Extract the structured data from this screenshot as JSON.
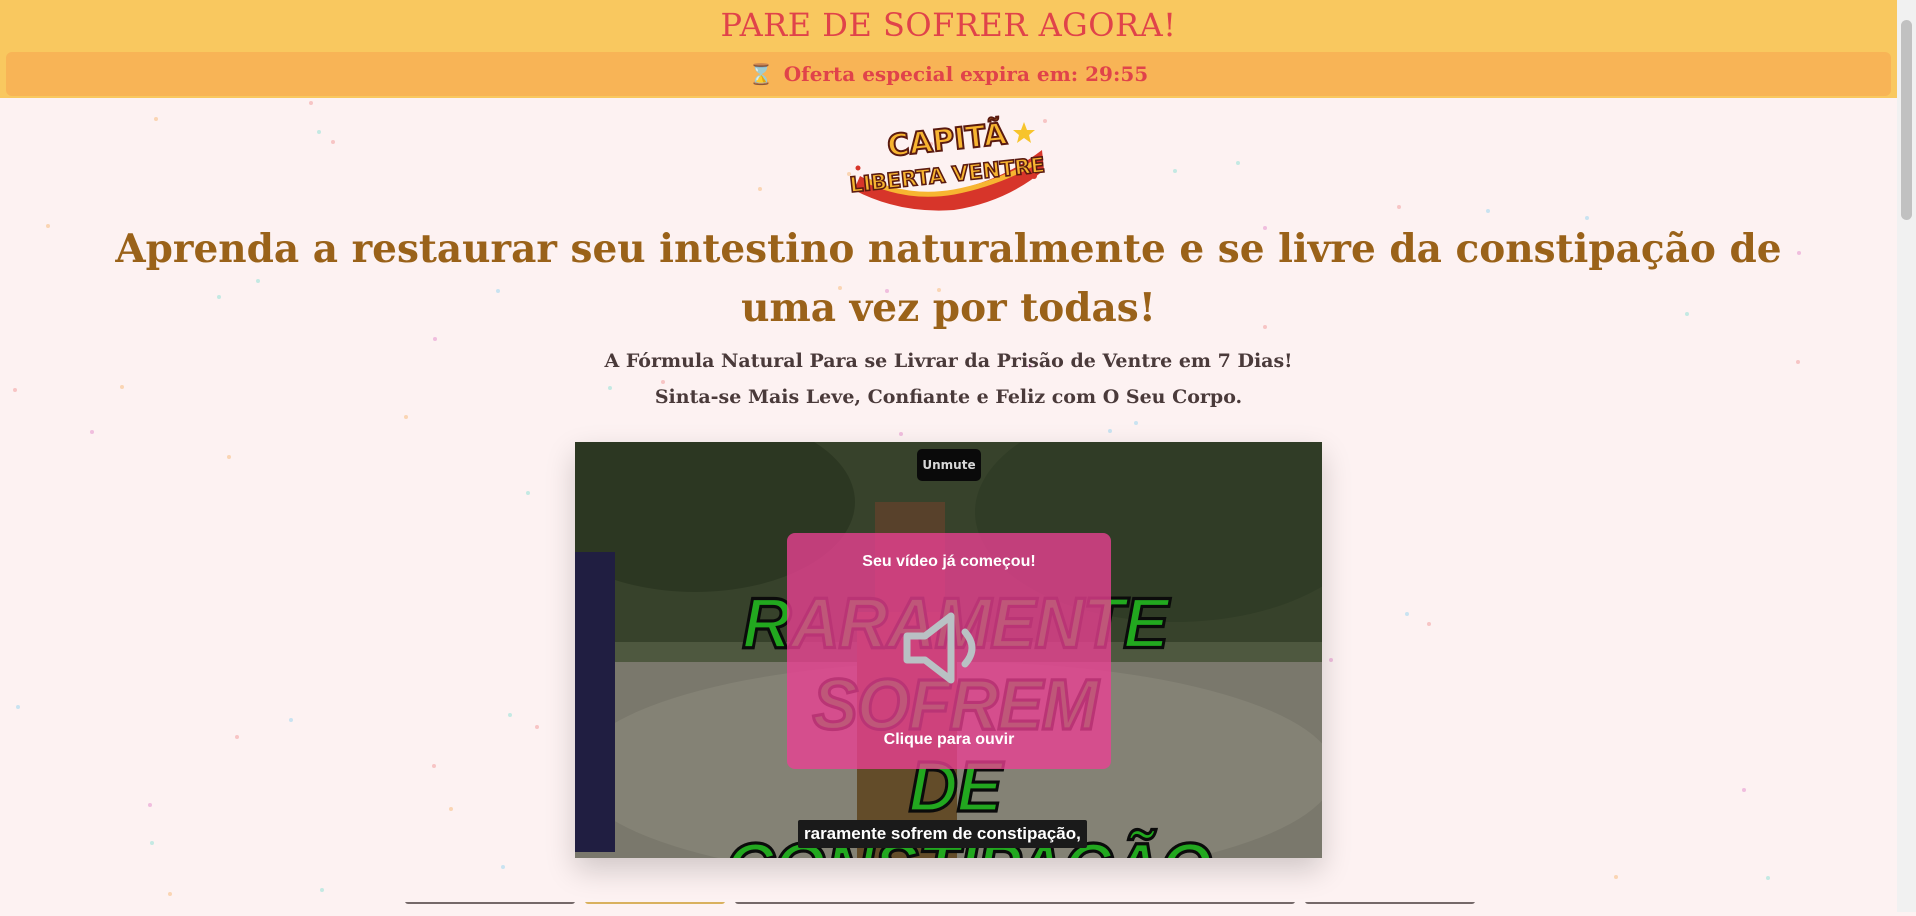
{
  "banner": {
    "title": "PARE DE SOFRER AGORA!",
    "timer_icon": "hourglass-icon",
    "timer_text": "Oferta especial expira em: 29:55"
  },
  "logo": {
    "line1": "CAPITÃ",
    "line2": "LIBERTA VENTRE"
  },
  "hero": {
    "headline": "Aprenda a restaurar seu intestino naturalmente e se livre da constipação de uma vez por todas!",
    "subtitle_1": "A Fórmula Natural Para se Livrar da Prisão de Ventre em 7 Dias!",
    "subtitle_2": "Sinta-se Mais Leve, Confiante e Feliz com O Seu Corpo."
  },
  "video": {
    "unmute_label": "Unmute",
    "overlay_line1": "RARAMENTE SOFREM",
    "overlay_line2": "DE CONSTIPAÇÃO",
    "sound_title": "Seu vídeo já começou!",
    "sound_cta": "Clique para ouvir",
    "caption": "raramente sofrem de constipação,"
  },
  "colors": {
    "banner_bg": "#f9c85f",
    "timer_bg": "#f8b456",
    "accent_red": "#e0434a",
    "headline": "#9a6219",
    "sound_card": "#ec4094",
    "page_bg": "#fdf2f2"
  }
}
